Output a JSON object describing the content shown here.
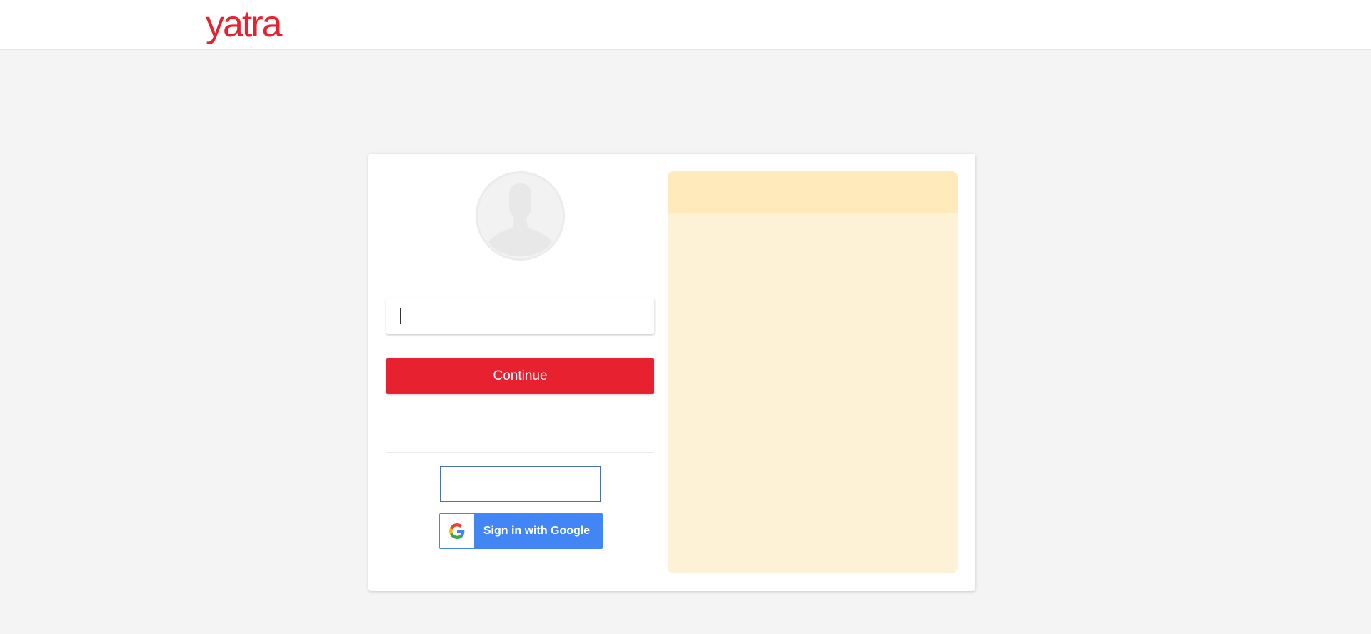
{
  "header": {
    "logo_text": "yatra"
  },
  "login": {
    "input_value": "",
    "continue_label": "Continue",
    "google_button_label": "Sign in with Google"
  },
  "colors": {
    "brand_red": "#e7212f",
    "google_blue": "#4285f4",
    "promo_panel": "#fdf1d6",
    "promo_header": "#feeaba"
  },
  "icons": {
    "avatar": "user-silhouette-icon",
    "google": "google-g-icon"
  }
}
